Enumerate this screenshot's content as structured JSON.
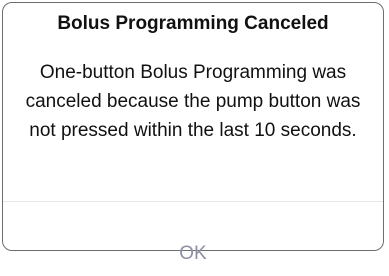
{
  "alert": {
    "title": "Bolus Programming Canceled",
    "message": "One-button Bolus Programming was canceled because the pump button was not pressed within the last 10 seconds.",
    "ok_label": "OK"
  },
  "colors": {
    "button_text": "#8d8fa3",
    "border": "#6e6e6e",
    "text": "#111111"
  }
}
